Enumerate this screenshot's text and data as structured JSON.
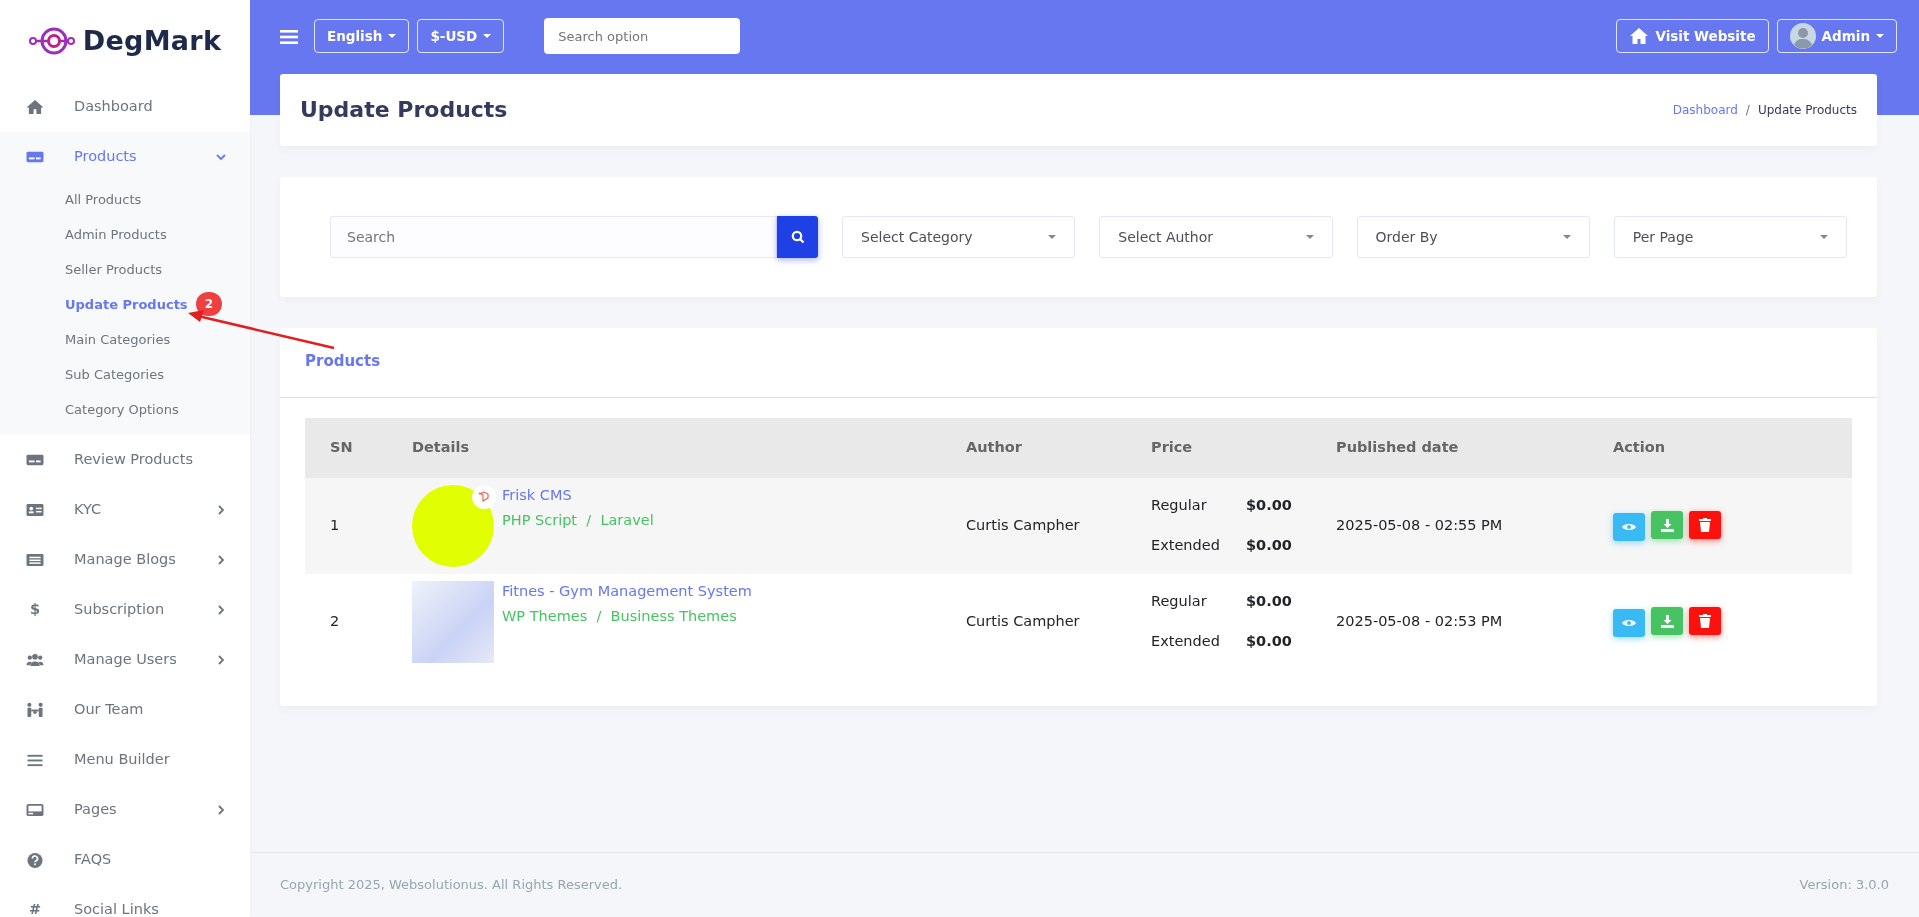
{
  "sidebar": {
    "logo": "DegMark",
    "items": [
      {
        "label": "Dashboard",
        "kind": "link",
        "selected": false
      },
      {
        "label": "Products",
        "kind": "group",
        "expanded": true,
        "selected": true,
        "children": [
          {
            "label": "All Products",
            "selected": false
          },
          {
            "label": "Admin Products",
            "selected": false
          },
          {
            "label": "Seller Products",
            "selected": false
          },
          {
            "label": "Update Products",
            "selected": true
          },
          {
            "label": "Main Categories",
            "selected": false
          },
          {
            "label": "Sub Categories",
            "selected": false
          },
          {
            "label": "Category Options",
            "selected": false
          }
        ]
      },
      {
        "label": "Review Products",
        "kind": "link",
        "selected": false
      },
      {
        "label": "KYC",
        "kind": "group",
        "expanded": false,
        "selected": false
      },
      {
        "label": "Manage Blogs",
        "kind": "group",
        "expanded": false,
        "selected": false
      },
      {
        "label": "Subscription",
        "kind": "group",
        "expanded": false,
        "selected": false,
        "glyph": "$"
      },
      {
        "label": "Manage Users",
        "kind": "group",
        "expanded": false,
        "selected": false
      },
      {
        "label": "Our Team",
        "kind": "link",
        "selected": false
      },
      {
        "label": "Menu Builder",
        "kind": "link",
        "selected": false
      },
      {
        "label": "Pages",
        "kind": "group",
        "expanded": false,
        "selected": false
      },
      {
        "label": "FAQS",
        "kind": "link",
        "selected": false
      },
      {
        "label": "Social Links",
        "kind": "link",
        "selected": false,
        "glyph": "#"
      }
    ]
  },
  "topbar": {
    "language": "English",
    "currency": "$-USD",
    "search": {
      "placeholder": "Search option"
    },
    "visit_button": "Visit Website",
    "user": "Admin"
  },
  "page_header": {
    "title": "Update Products",
    "separator": "/",
    "breadcrumb": [
      {
        "label": "Dashboard",
        "active": false
      },
      {
        "label": "Update Products",
        "active": true
      }
    ]
  },
  "filters": {
    "search": {
      "placeholder": "Search"
    },
    "selects": [
      "Select Category",
      "Select Author",
      "Order By",
      "Per Page"
    ]
  },
  "products": {
    "title": "Products",
    "table": {
      "columns": [
        "SN",
        "Details",
        "Author",
        "Price",
        "Published date",
        "Action"
      ],
      "rows": [
        {
          "sn": "1",
          "kind": "logo",
          "title": "Frisk CMS",
          "category": "PHP Script  /  Laravel",
          "author": "Curtis Campher",
          "prices": [
            {
              "label": "Regular",
              "amount": "$0.00"
            },
            {
              "label": "Extended",
              "amount": "$0.00"
            }
          ],
          "published": "2025-05-08 - 02:55 PM"
        },
        {
          "sn": "2",
          "kind": "screenshot",
          "title": "Fitnes - Gym Management System",
          "category": "WP Themes  /  Business Themes",
          "author": "Curtis Campher",
          "prices": [
            {
              "label": "Regular",
              "amount": "$0.00"
            },
            {
              "label": "Extended",
              "amount": "$0.00"
            }
          ],
          "published": "2025-05-08 - 02:53 PM"
        }
      ]
    }
  },
  "footer": {
    "copyright": "Copyright 2025, Websolutionus. All Rights Reserved.",
    "version": "Version: 3.0.0"
  },
  "annotation": {
    "badge": "2"
  }
}
